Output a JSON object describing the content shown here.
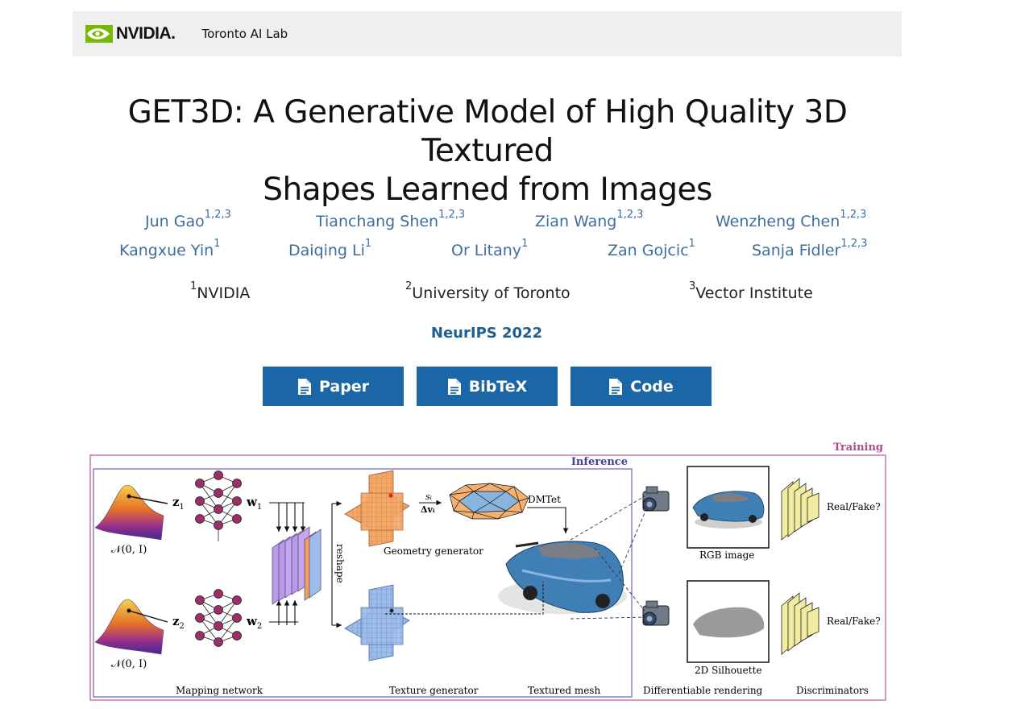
{
  "header": {
    "logo_text": "NVIDIA.",
    "lab_name": "Toronto AI Lab"
  },
  "title": {
    "line1": "GET3D: A Generative Model of High Quality 3D Textured",
    "line2": "Shapes Learned from Images"
  },
  "authors": [
    {
      "name": "Jun Gao",
      "aff": "1,2,3"
    },
    {
      "name": "Tianchang Shen",
      "aff": "1,2,3"
    },
    {
      "name": "Zian Wang",
      "aff": "1,2,3"
    },
    {
      "name": "Wenzheng Chen",
      "aff": "1,2,3"
    },
    {
      "name": "Kangxue Yin",
      "aff": "1"
    },
    {
      "name": "Daiqing Li",
      "aff": "1"
    },
    {
      "name": "Or Litany",
      "aff": "1"
    },
    {
      "name": "Zan Gojcic",
      "aff": "1"
    },
    {
      "name": "Sanja Fidler",
      "aff": "1,2,3"
    }
  ],
  "affiliations": [
    {
      "num": "1",
      "name": "NVIDIA"
    },
    {
      "num": "2",
      "name": "University of Toronto"
    },
    {
      "num": "3",
      "name": "Vector Institute"
    }
  ],
  "venue": "NeurIPS 2022",
  "buttons": {
    "paper": "Paper",
    "bibtex": "BibTeX",
    "code": "Code"
  },
  "figure": {
    "training": "Training",
    "inference": "Inference",
    "z1": "z",
    "z1_sub": "1",
    "z2": "z",
    "z2_sub": "2",
    "w1": "w",
    "w1_sub": "1",
    "w2": "w",
    "w2_sub": "2",
    "normal_dist": "𝒩(0, I)",
    "reshape": "reshape",
    "si": "sᵢ",
    "dvi": "Δvᵢ",
    "dmtet": "DMTet",
    "geometry_generator": "Geometry generator",
    "texture_generator": "Texture generator",
    "textured_mesh": "Textured mesh",
    "mapping_network": "Mapping network",
    "differentiable_rendering": "Differentiable rendering",
    "discriminators": "Discriminators",
    "rgb_image": "RGB image",
    "silhouette": "2D Silhouette",
    "real_fake": "Real/Fake?",
    "colors": {
      "training_frame": "#c0609a",
      "inference_frame": "#7a6cc0",
      "geometry_plane": "#f0a060",
      "texture_plane": "#8fb3e6",
      "feature_maps": "#b99ae6",
      "discriminator": "#f2eca0"
    }
  }
}
